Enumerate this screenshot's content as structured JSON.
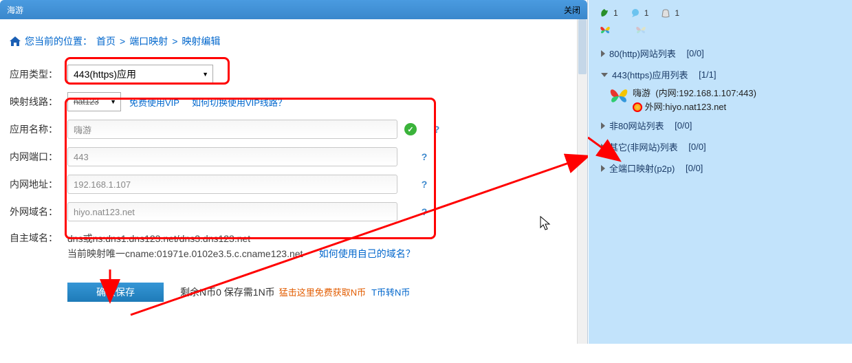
{
  "titlebar": {
    "title": "海游",
    "close": "关闭"
  },
  "breadcrumb": {
    "label": "您当前的位置：",
    "home": "首页",
    "port_mapping": "端口映射",
    "edit": "映射编辑"
  },
  "form": {
    "app_type_label": "应用类型：",
    "app_type_value": "443(https)应用",
    "line_label": "映射线路：",
    "line_value": "nat123",
    "line_free_vip": "免费使用VIP",
    "line_switch_q": "如何切换使用VIP线路？",
    "app_name_label": "应用名称：",
    "app_name_value": "嗨游",
    "inner_port_label": "内网端口：",
    "inner_port_value": "443",
    "inner_addr_label": "内网地址：",
    "inner_addr_value": "192.168.1.107",
    "outer_domain_label": "外网域名：",
    "outer_domain_value": "hiyo.nat123.net",
    "own_domain_label": "自主域名：",
    "dns_line1": "dns或ns:dns1.dns123.net/dns3.dns123.net",
    "dns_line2": "当前映射唯一cname:01971e.0102e3.5.c.cname123.net",
    "own_domain_q": "如何使用自己的域名？",
    "confirm": "确认保存",
    "coin_remain": "剩余N币0 保存需1N币",
    "coin_get": "猛击这里免费获取N币",
    "coin_transfer": "T币转N币"
  },
  "side": {
    "icon_counts": [
      "1",
      "1",
      "1"
    ],
    "tree": {
      "http": {
        "label": "80(http)网站列表",
        "count": "[0/0]"
      },
      "https": {
        "label": "443(https)应用列表",
        "count": "[1/1]"
      },
      "https_child": {
        "name": "嗨游",
        "inner": "(内网:192.168.1.107:443)",
        "outer": "外网:hiyo.nat123.net"
      },
      "non80": {
        "label": "非80网站列表",
        "count": "[0/0]"
      },
      "other": {
        "label": "其它(非网站)列表",
        "count": "[0/0]"
      },
      "p2p": {
        "label": "全端口映射(p2p)",
        "count": "[0/0]"
      }
    }
  }
}
